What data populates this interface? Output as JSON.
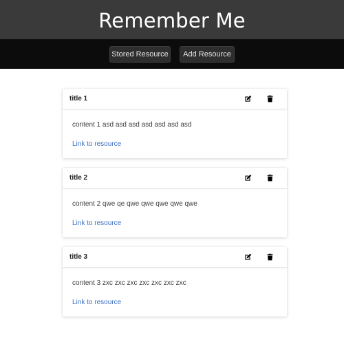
{
  "header": {
    "title": "Remember Me"
  },
  "nav": {
    "stored_label": "Stored Resource",
    "add_label": "Add Resource"
  },
  "resources": [
    {
      "title": "title 1",
      "content": "content 1 asd asd asd asd asd asd asd",
      "link_label": "Link to resource"
    },
    {
      "title": "title 2",
      "content": "content 2 qwe qe qwe qwe qwe qwe qwe",
      "link_label": "Link to resource"
    },
    {
      "title": "title 3",
      "content": "content 3 zxc zxc zxc zxc zxc zxc zxc",
      "link_label": "Link to resource"
    }
  ],
  "icons": {
    "edit": "edit-icon",
    "delete": "trash-icon"
  },
  "colors": {
    "header_bg": "#3a3a3a",
    "nav_bg": "#0c0c0c",
    "button_bg": "#2e2e2e",
    "link": "#3d6fc4"
  }
}
